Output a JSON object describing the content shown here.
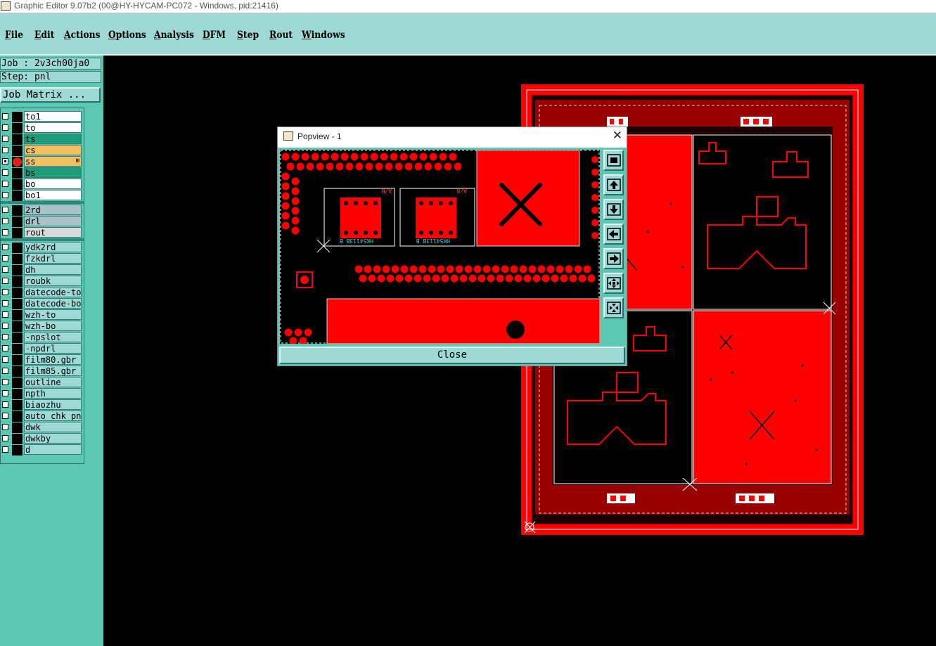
{
  "window": {
    "title": "Graphic Editor 9.07b2 (00@HY-HYCAM-PC072 - Windows, pid:21416)"
  },
  "menu": {
    "items": [
      {
        "ul": "F",
        "rest": "ile"
      },
      {
        "ul": "E",
        "rest": "dit"
      },
      {
        "ul": "A",
        "rest": "ctions"
      },
      {
        "ul": "O",
        "rest": "ptions"
      },
      {
        "ul": "A",
        "rest": "nalysis"
      },
      {
        "ul": "D",
        "rest": "FM"
      },
      {
        "ul": "S",
        "rest": "tep"
      },
      {
        "ul": "R",
        "rest": "out"
      },
      {
        "ul": "W",
        "rest": "indows"
      }
    ]
  },
  "job": {
    "job_label": "Job : 2v3ch00ja0",
    "step_label": "Step: pnl",
    "matrix_button": "Job Matrix ..."
  },
  "layers": [
    {
      "name": "to1",
      "color": "#ffffff",
      "active": false
    },
    {
      "name": "to",
      "color": "#ffffff",
      "active": false
    },
    {
      "name": "ts",
      "color": "#1e9c78",
      "active": false
    },
    {
      "name": "cs",
      "color": "#f0c060",
      "active": false
    },
    {
      "name": "ss",
      "color": "#f0c060",
      "active": true
    },
    {
      "name": "bs",
      "color": "#1e9c78",
      "active": false
    },
    {
      "name": "bo",
      "color": "#ffffff",
      "active": false
    },
    {
      "name": "bo1",
      "color": "#ffffff",
      "active": false
    },
    {
      "name": "2rd",
      "color": "#a9c2c8",
      "active": false
    },
    {
      "name": "drl",
      "color": "#a9c2c8",
      "active": false
    },
    {
      "name": "rout",
      "color": "#d8d8d8",
      "active": false
    },
    {
      "name": "ydk2rd",
      "color": "#9fd9d6",
      "active": false
    },
    {
      "name": "fzkdrl",
      "color": "#9fd9d6",
      "active": false
    },
    {
      "name": "dh",
      "color": "#9fd9d6",
      "active": false
    },
    {
      "name": "roubk",
      "color": "#9fd9d6",
      "active": false
    },
    {
      "name": "datecode-to",
      "color": "#9fd9d6",
      "active": false
    },
    {
      "name": "datecode-bo",
      "color": "#9fd9d6",
      "active": false
    },
    {
      "name": "wzh-to",
      "color": "#9fd9d6",
      "active": false
    },
    {
      "name": "wzh-bo",
      "color": "#9fd9d6",
      "active": false
    },
    {
      "name": "-npslot",
      "color": "#9fd9d6",
      "active": false
    },
    {
      "name": "-npdrl",
      "color": "#9fd9d6",
      "active": false
    },
    {
      "name": "film80.gbr",
      "color": "#9fd9d6",
      "active": false
    },
    {
      "name": "film85.gbr",
      "color": "#9fd9d6",
      "active": false
    },
    {
      "name": "outline",
      "color": "#9fd9d6",
      "active": false
    },
    {
      "name": "npth",
      "color": "#9fd9d6",
      "active": false
    },
    {
      "name": "biaozhu",
      "color": "#9fd9d6",
      "active": false
    },
    {
      "name": "auto_chk_pnl",
      "color": "#9fd9d6",
      "active": false
    },
    {
      "name": "dwk",
      "color": "#9fd9d6",
      "active": false
    },
    {
      "name": "dwkby",
      "color": "#9fd9d6",
      "active": false
    },
    {
      "name": "d",
      "color": "#9fd9d6",
      "active": false
    }
  ],
  "popview": {
    "title": "Popview - 1",
    "close_button": "Close",
    "text_labels": [
      "HK54113B_B",
      "HK54113B_B",
      "A/B",
      "A/B"
    ]
  }
}
